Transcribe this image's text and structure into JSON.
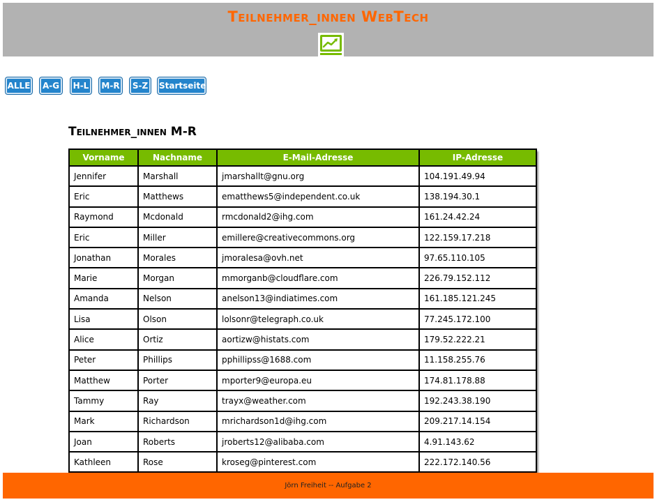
{
  "header": {
    "title": "Teilnehmer_innen WebTech",
    "logo_icon": "line-chart-icon",
    "accent_color": "#ff6600"
  },
  "nav": {
    "buttons": [
      {
        "label": "ALLE"
      },
      {
        "label": "A-G"
      },
      {
        "label": "H-L"
      },
      {
        "label": "M-R"
      },
      {
        "label": "S-Z"
      },
      {
        "label": "Startseite"
      }
    ]
  },
  "section": {
    "title": "Teilnehmer_innen M-R"
  },
  "table": {
    "columns": [
      "Vorname",
      "Nachname",
      "E-Mail-Adresse",
      "IP-Adresse"
    ],
    "header_color": "#77bb00",
    "rows": [
      [
        "Jennifer",
        "Marshall",
        "jmarshallt@gnu.org",
        "104.191.49.94"
      ],
      [
        "Eric",
        "Matthews",
        "ematthews5@independent.co.uk",
        "138.194.30.1"
      ],
      [
        "Raymond",
        "Mcdonald",
        "rmcdonald2@ihg.com",
        "161.24.42.24"
      ],
      [
        "Eric",
        "Miller",
        "emillere@creativecommons.org",
        "122.159.17.218"
      ],
      [
        "Jonathan",
        "Morales",
        "jmoralesa@ovh.net",
        "97.65.110.105"
      ],
      [
        "Marie",
        "Morgan",
        "mmorganb@cloudflare.com",
        "226.79.152.112"
      ],
      [
        "Amanda",
        "Nelson",
        "anelson13@indiatimes.com",
        "161.185.121.245"
      ],
      [
        "Lisa",
        "Olson",
        "lolsonr@telegraph.co.uk",
        "77.245.172.100"
      ],
      [
        "Alice",
        "Ortiz",
        "aortizw@histats.com",
        "179.52.222.21"
      ],
      [
        "Peter",
        "Phillips",
        "pphillipss@1688.com",
        "11.158.255.76"
      ],
      [
        "Matthew",
        "Porter",
        "mporter9@europa.eu",
        "174.81.178.88"
      ],
      [
        "Tammy",
        "Ray",
        "trayx@weather.com",
        "192.243.38.190"
      ],
      [
        "Mark",
        "Richardson",
        "mrichardson1d@ihg.com",
        "209.217.14.154"
      ],
      [
        "Joan",
        "Roberts",
        "jroberts12@alibaba.com",
        "4.91.143.62"
      ],
      [
        "Kathleen",
        "Rose",
        "kroseg@pinterest.com",
        "222.172.140.56"
      ]
    ]
  },
  "footer": {
    "text": "Jörn Freiheit -- Aufgabe 2"
  }
}
